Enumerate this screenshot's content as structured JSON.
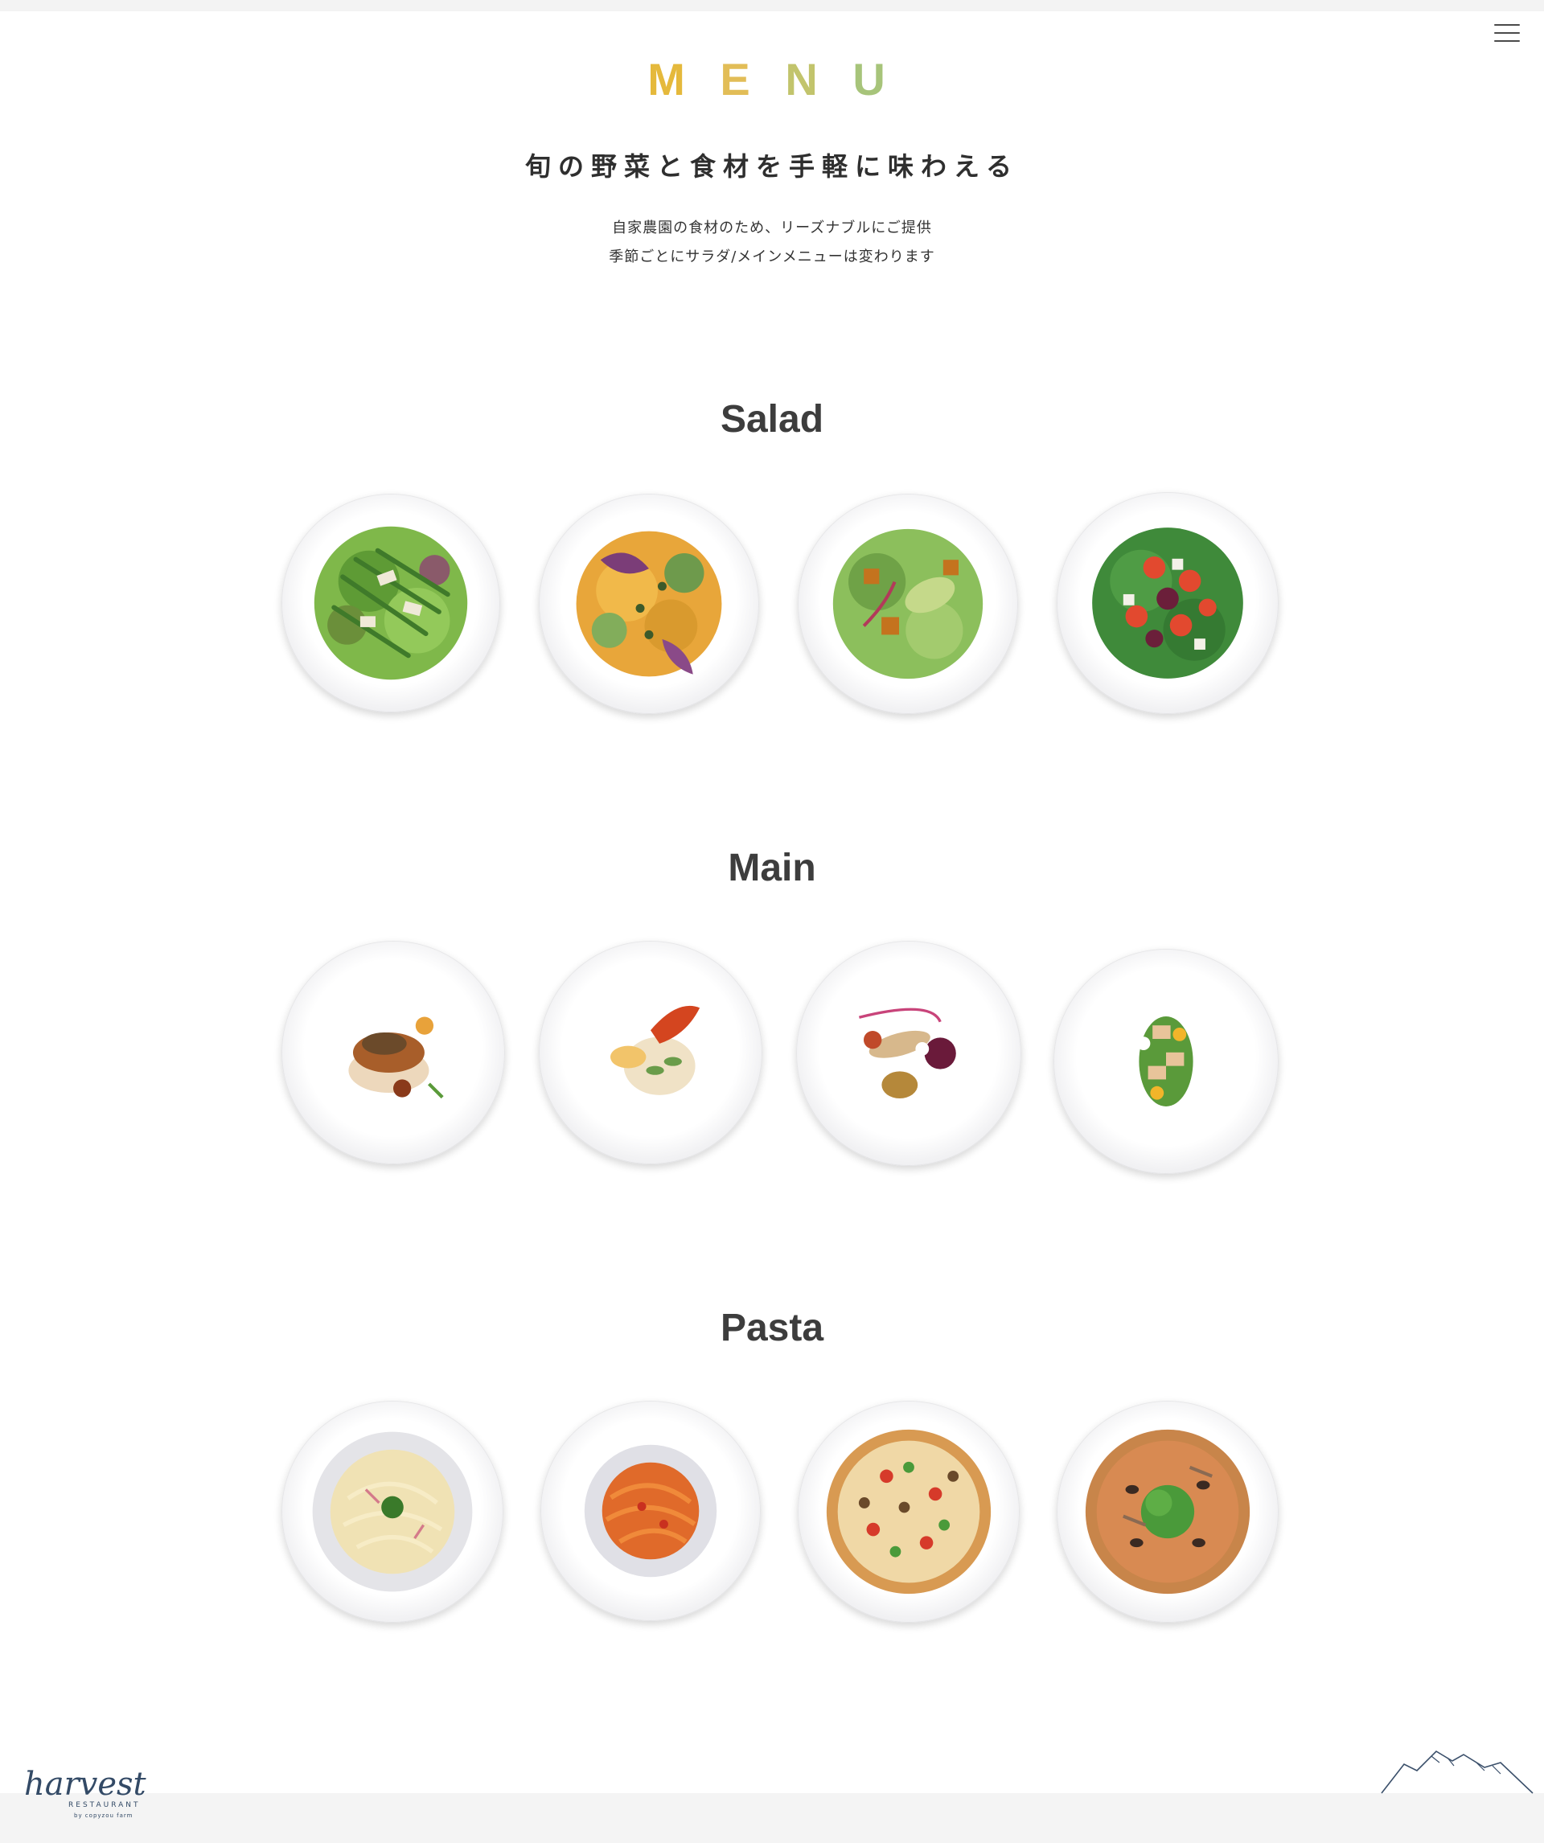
{
  "header": {
    "title_letters": [
      {
        "char": "M",
        "color": "#E5B93C"
      },
      {
        "char": "E",
        "color": "#E2BD57"
      },
      {
        "char": "N",
        "color": "#C2C46C"
      },
      {
        "char": "U",
        "color": "#A7C47A"
      }
    ],
    "headline": "旬の野菜と食材を手軽に味わえる",
    "intro_line1": "自家農園の食材のため、リーズナブルにご提供",
    "intro_line2": "季節ごとにサラダ/メインメニューは変わります"
  },
  "sections": [
    {
      "title": "Salad",
      "dishes": [
        "asparagus-salad",
        "pumpkin-salad",
        "avocado-salad",
        "tomato-feta-salad"
      ]
    },
    {
      "title": "Main",
      "dishes": [
        "roast-chicken",
        "shrimp-risotto",
        "fish-with-sauce",
        "tuna-salad-plate"
      ]
    },
    {
      "title": "Pasta",
      "dishes": [
        "carbonara",
        "tomato-tagliatelle",
        "vegetable-pizza",
        "anchovy-pizza"
      ]
    }
  ],
  "footer": {
    "logo_script": "harvest",
    "logo_sub": "RESTAURANT",
    "logo_tag": "by copyzou farm"
  },
  "icons": {
    "menu": "hamburger-icon",
    "logo": "harvest-logo",
    "decoration": "mountain-icon"
  }
}
